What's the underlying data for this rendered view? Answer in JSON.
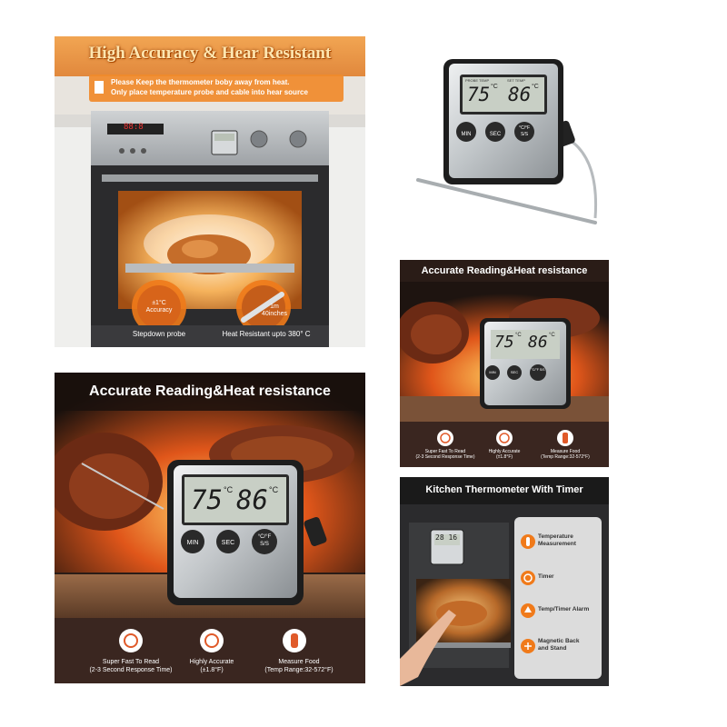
{
  "panel_oven": {
    "title": "High Accuracy & Hear Resistant",
    "note_line1": "Please Keep the thermometer boby away from heat.",
    "note_line2": "Only place temperature probe and cable into hear source",
    "bubble1_line1": "±1°C",
    "bubble1_line2": "Accuracy",
    "bubble2_line1": "1m",
    "bubble2_line2": "40inches",
    "caption_left": "Stepdown probe",
    "caption_right": "Heat Resistant upto 380° C",
    "oven_display": "88:8"
  },
  "panel_product": {
    "label_left": "PROBE TEMP",
    "label_right": "SET TEMP",
    "temp1": "75",
    "temp2": "86",
    "unit": "°C",
    "btn1": "MIN",
    "btn2": "SEC",
    "btn3_top": "°C/°F",
    "btn3_bottom": "S/S"
  },
  "panel_small_grill": {
    "title": "Accurate Reading&Heat resistance",
    "temp1": "75",
    "temp2": "86",
    "unit": "°C",
    "btn1": "MIN",
    "btn2": "SEC",
    "btn3": "°C/°F S/S",
    "feat1_line1": "Super Fast To Read",
    "feat1_line2": "(2-3 Second Response Time)",
    "feat2_line1": "Highly Accurate",
    "feat2_line2": "(±1.8°F)",
    "feat3_line1": "Measure Food",
    "feat3_line2": "(Temp Range:32-572°F)"
  },
  "panel_big_grill": {
    "title": "Accurate Reading&Heat resistance",
    "temp1": "75",
    "temp2": "86",
    "unit": "°C",
    "btn1": "MIN",
    "btn2": "SEC",
    "btn3_top": "°C/°F",
    "btn3_bottom": "S/S",
    "feat1_line1": "Super Fast To Read",
    "feat1_line2": "(2-3 Second Response Time)",
    "feat2_line1": "Highly Accurate",
    "feat2_line2": "(±1.8°F)",
    "feat3_line1": "Measure Food",
    "feat3_line2": "(Temp Range:32-572°F)"
  },
  "panel_kitchen": {
    "title": "Kitchen Thermometer With Timer",
    "display": "28 16",
    "features": [
      {
        "label_line1": "Temperature",
        "label_line2": "Measurement"
      },
      {
        "label_line1": "Timer",
        "label_line2": ""
      },
      {
        "label_line1": "Temp/Timer Alarm",
        "label_line2": ""
      },
      {
        "label_line1": "Magnetic Back",
        "label_line2": "and Stand"
      }
    ]
  },
  "colors": {
    "orange": "#f07a1a",
    "dark_bg": "#2a1c17",
    "feature_bar": "#3a2620",
    "silver": "#c9cdd0",
    "lcd": "#c8cfc5"
  }
}
